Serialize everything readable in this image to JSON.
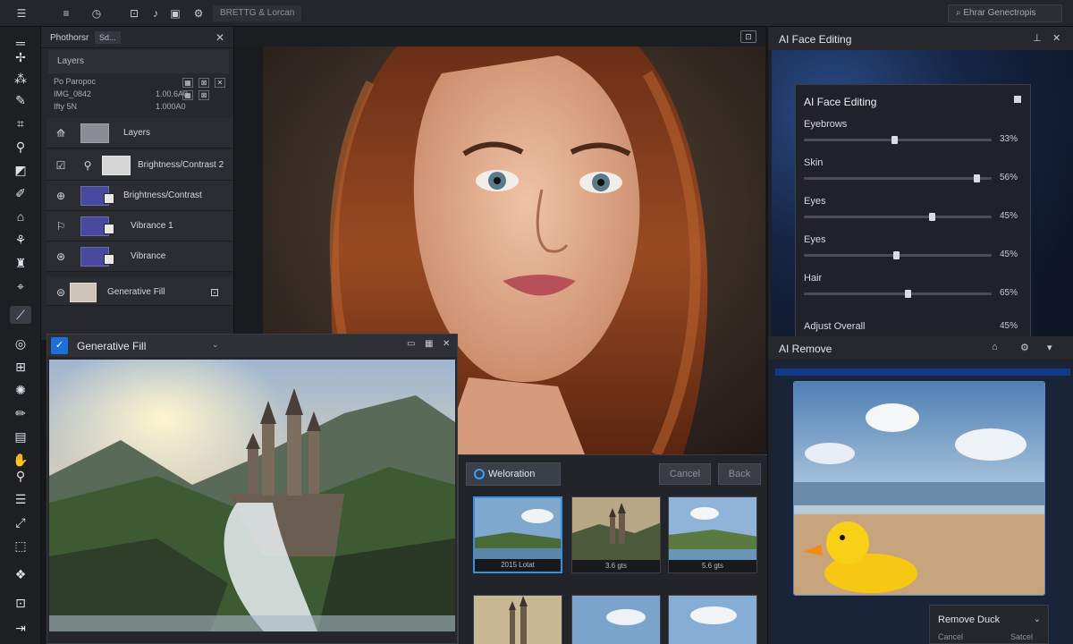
{
  "topbar": {
    "title": "BRETTG & Lorcan",
    "search": "Ehrar Genectropis",
    "icons": [
      "hamburger-icon",
      "clock-icon",
      "frame-icon",
      "music-icon",
      "image-icon",
      "settings-icon"
    ]
  },
  "layers_panel": {
    "header_title": "Phothorsr",
    "header_chip": "Sd...",
    "tab_label": "Layers",
    "info_rows": [
      {
        "left": "Po Paropoc",
        "right": ""
      },
      {
        "left": "IMG_0842",
        "right": "1.00.6A0"
      },
      {
        "left": "Ifty 5N",
        "right": "1.000A0"
      }
    ],
    "layers": [
      {
        "name": "Layers"
      },
      {
        "name": "Brightness/Contrast 2"
      },
      {
        "name": "Brightness/Contrast"
      },
      {
        "name": "Vibrance 1"
      },
      {
        "name": "Vibrance"
      },
      {
        "name": "Generative Fill"
      }
    ]
  },
  "generative_fill": {
    "title": "Generative Fill"
  },
  "weloration": {
    "button": "Weloration",
    "cancel": "Cancel",
    "back": "Back",
    "thumbs": [
      {
        "caption": "2015 Lotat"
      },
      {
        "caption": "3.6 gts"
      },
      {
        "caption": "5.6 gts"
      }
    ]
  },
  "ai_face_editing": {
    "header": "AI Face Editing",
    "card_title": "AI Face Editing",
    "sliders": [
      {
        "label": "Eyebrows",
        "value": "33%",
        "level": 0.48
      },
      {
        "label": "Skin",
        "value": "56%",
        "level": 0.92
      },
      {
        "label": "Eyes",
        "value": "45%",
        "level": 0.68
      },
      {
        "label": "Eyes",
        "value": "45%",
        "level": 0.49
      },
      {
        "label": "Hair",
        "value": "65%",
        "level": 0.55
      }
    ],
    "overall_label": "Adjust Overall",
    "overall_value": "45%"
  },
  "ai_remove": {
    "header": "AI Remove",
    "menu_label": "Remove Duck",
    "menu_cancel": "Cancel",
    "menu_select": "Satcel"
  }
}
